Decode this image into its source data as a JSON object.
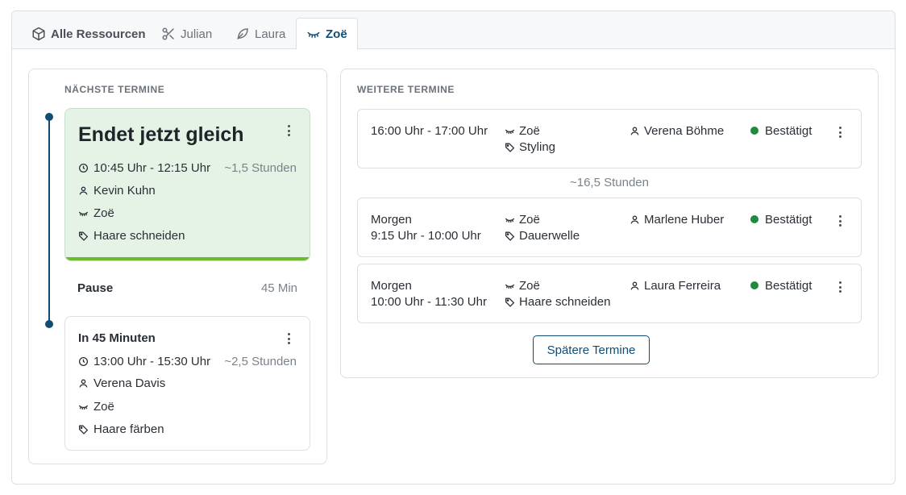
{
  "tabs": [
    {
      "label": "Alle Ressourcen",
      "icon": "cube-icon"
    },
    {
      "label": "Julian",
      "icon": "scissors-icon"
    },
    {
      "label": "Laura",
      "icon": "leaf-icon"
    },
    {
      "label": "Zoë",
      "icon": "eyelashes-icon",
      "active": true
    }
  ],
  "left": {
    "section_label": "NÄCHSTE TERMINE",
    "current": {
      "title": "Endet jetzt gleich",
      "time": "10:45 Uhr - 12:15 Uhr",
      "duration": "~1,5 Stunden",
      "customer": "Kevin Kuhn",
      "resource": "Zoë",
      "service": "Haare schneiden",
      "progress_color": "#6dba2e"
    },
    "pause": {
      "label": "Pause",
      "duration": "45 Min"
    },
    "next": {
      "title": "In 45 Minuten",
      "time": "13:00 Uhr - 15:30 Uhr",
      "duration": "~2,5 Stunden",
      "customer": "Verena Davis",
      "resource": "Zoë",
      "service": "Haare färben"
    }
  },
  "right": {
    "section_label": "WEITERE TERMINE",
    "gap_label": "~16,5 Stunden",
    "appointments": [
      {
        "line1": "16:00 Uhr - 17:00 Uhr",
        "line2": "",
        "resource": "Zoë",
        "service": "Styling",
        "customer": "Verena Böhme",
        "status": "Bestätigt"
      },
      {
        "line1": "Morgen",
        "line2": "9:15 Uhr - 10:00 Uhr",
        "resource": "Zoë",
        "service": "Dauerwelle",
        "customer": "Marlene Huber",
        "status": "Bestätigt"
      },
      {
        "line1": "Morgen",
        "line2": "10:00 Uhr - 11:30 Uhr",
        "resource": "Zoë",
        "service": "Haare schneiden",
        "customer": "Laura Ferreira",
        "status": "Bestätigt"
      }
    ],
    "later_button": "Spätere Termine",
    "status_color": "#1e8a3c"
  }
}
